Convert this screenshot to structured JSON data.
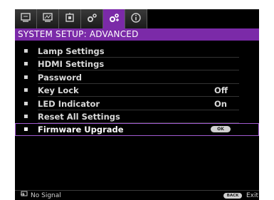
{
  "tabs": [
    {
      "icon": "display-icon",
      "glyph": "⛶"
    },
    {
      "icon": "picture-settings-icon",
      "glyph": "⛶"
    },
    {
      "icon": "source-icon",
      "glyph": "⎙"
    },
    {
      "icon": "system-setup-basic-icon",
      "glyph": "⚙"
    },
    {
      "icon": "system-setup-advanced-icon",
      "glyph": "⚙"
    },
    {
      "icon": "information-icon",
      "glyph": "ⓘ"
    }
  ],
  "section_title": "SYSTEM SETUP: ADVANCED",
  "menu": [
    {
      "label": "Lamp Settings",
      "value": ""
    },
    {
      "label": "HDMI Settings",
      "value": ""
    },
    {
      "label": "Password",
      "value": ""
    },
    {
      "label": "Key Lock",
      "value": "Off"
    },
    {
      "label": "LED Indicator",
      "value": "On"
    },
    {
      "label": "Reset All Settings",
      "value": ""
    },
    {
      "label": "Firmware Upgrade",
      "value": "",
      "button": "OK"
    }
  ],
  "status": {
    "source_text": "No Signal",
    "back_button": "BACK",
    "exit_text": "Exit"
  },
  "colors": {
    "accent": "#7b2aa8",
    "background": "#000000",
    "text": "#d8d8d8"
  }
}
